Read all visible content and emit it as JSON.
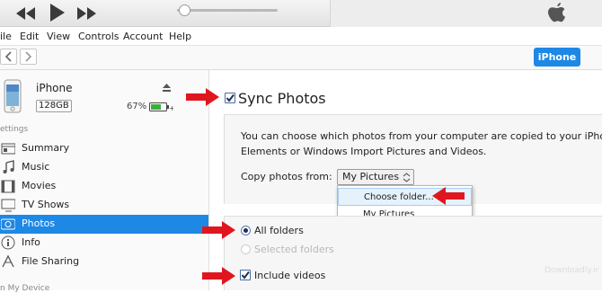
{
  "menubar": {
    "items": [
      "ile",
      "Edit",
      "View",
      "Controls",
      "Account",
      "Help"
    ]
  },
  "navbar": {
    "device_button": "iPhone"
  },
  "device": {
    "name": "iPhone",
    "capacity": "128GB",
    "battery": "67%"
  },
  "sidebar": {
    "settings_heading": "ettings",
    "items": [
      {
        "label": "Summary",
        "icon": "summary-icon"
      },
      {
        "label": "Music",
        "icon": "music-icon"
      },
      {
        "label": "Movies",
        "icon": "movies-icon"
      },
      {
        "label": "TV Shows",
        "icon": "tv-icon"
      },
      {
        "label": "Photos",
        "icon": "photos-icon",
        "active": true
      },
      {
        "label": "Info",
        "icon": "info-icon"
      },
      {
        "label": "File Sharing",
        "icon": "file-sharing-icon"
      }
    ],
    "on_device_heading": "n My Device"
  },
  "photos": {
    "sync_label": "Sync Photos",
    "sync_checked": true,
    "description_line1": "You can choose which photos from your computer are copied to your iPhone",
    "description_line2": "Elements or Windows Import Pictures and Videos.",
    "copy_from_label": "Copy photos from:",
    "copy_from_value": "My Pictures",
    "dropdown_options": [
      "Choose folder...",
      "My Pictures"
    ],
    "all_folders_label": "All folders",
    "selected_folders_label": "Selected folders",
    "include_videos_label": "Include videos",
    "include_videos_checked": true
  },
  "watermark": "Downloadly.ir",
  "colors": {
    "accent": "#1e88e5",
    "arrow": "#e0161f"
  }
}
